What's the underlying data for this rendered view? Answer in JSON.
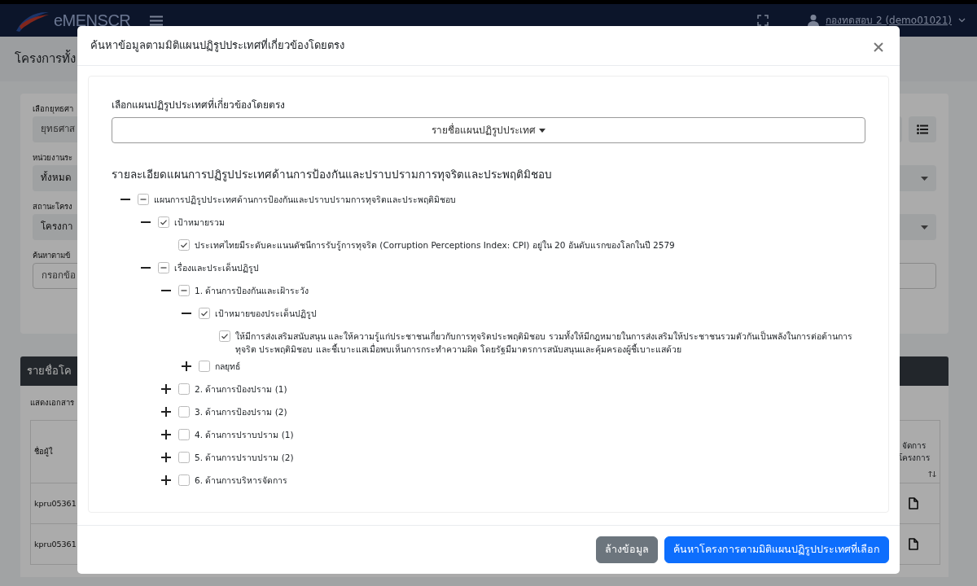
{
  "navbar": {
    "brand": "eMENSCR",
    "user": "กองทดสอบ 2 (demo01021)"
  },
  "page": {
    "title": "โครงการทั้ง",
    "filters": [
      {
        "label": "เลือกยุทธศา",
        "kind": "select",
        "placeholder": "ยุทธศาส",
        "list_button": true
      },
      {
        "label": "หน่วยงานระ",
        "kind": "select",
        "value": "ทั้งหมด",
        "list_button": false
      },
      {
        "label": "สถานะโครง",
        "kind": "select",
        "value": "โครงกา",
        "list_button": false
      },
      {
        "label": "ค้นหาตามข้",
        "kind": "input",
        "placeholder": "กรอกข้อ",
        "list_button": false
      }
    ],
    "section_title": "รายชื่อโค",
    "caption": "แสดงเอกสาร",
    "table": {
      "columns": [
        {
          "label": "ชื่อผู้ใ"
        },
        {
          "label": "จัดการ โครงการ",
          "sortable": true
        }
      ],
      "rows": [
        {
          "cells": [
            "kpru05361"
          ]
        },
        {
          "cells": [
            "kpru05361"
          ]
        }
      ]
    }
  },
  "modal": {
    "title": "ค้นหาข้อมูลตามมิติแผนปฏิรูปประเทศที่เกี่ยวข้องโดยตรง",
    "select_label": "เลือกแผนปฏิรูปประเทศที่เกี่ยวข้องโดยตรง",
    "dropdown": "รายชื่อแผนปฏิรูปประเทศ",
    "detail_heading": "รายละเอียดแผนการปฏิรูปประเทศด้านการป้องกันและปราบปรามการทุจริตและประพฤติมิชอบ",
    "tree": [
      {
        "label": "แผนการปฏิรูปประเทศด้านการป้องกันและปราบปรามการทุจริตและประพฤติมิชอบ",
        "indeterminate": true,
        "expanded": true,
        "children": [
          {
            "label": "เป้าหมายรวม",
            "checked": true,
            "indeterminate": false,
            "expanded": true,
            "children": [
              {
                "label": "ประเทศไทยมีระดับคะแนนดัชนีการรับรู้การทุจริต (Corruption Perceptions Index: CPI) อยู่ใน 20 อันดับแรกของโลกในปี 2579",
                "checked": true,
                "indeterminate": false
              }
            ]
          },
          {
            "label": "เรื่องและประเด็นปฏิรูป",
            "indeterminate": true,
            "expanded": true,
            "children": [
              {
                "label": "1. ด้านการป้องกันและเฝ้าระวัง",
                "indeterminate": true,
                "expanded": true,
                "children": [
                  {
                    "label": "เป้าหมายของประเด็นปฏิรูป",
                    "checked": true,
                    "indeterminate": false,
                    "expanded": true,
                    "children": [
                      {
                        "label": "ให้มีการส่งเสริมสนับสนุน และให้ความรู้แก่ประชาชนเกี่ยวกับการทุจริตประพฤติมิชอบ รวมทั้งให้มีกฎหมายในการส่งเสริมให้ประชาชนรวมตัวกันเป็นพลังในการต่อต้านการทุจริต ประพฤติมิชอบ และชี้เบาะแสเมื่อพบเห็นการกระทำความผิด โดยรัฐมีมาตรการสนับสนุนและคุ้มครองผู้ชี้เบาะแสด้วย",
                        "checked": true,
                        "indeterminate": false
                      }
                    ]
                  },
                  {
                    "label": "กลยุทธ์",
                    "checked": false,
                    "indeterminate": false,
                    "expanded": false
                  }
                ]
              },
              {
                "label": "2. ด้านการป้องปราม (1)",
                "checked": false,
                "indeterminate": false,
                "expanded": false
              },
              {
                "label": "3. ด้านการป้องปราม (2)",
                "checked": false,
                "indeterminate": false,
                "expanded": false
              },
              {
                "label": "4. ด้านการปราบปราม (1)",
                "checked": false,
                "indeterminate": false,
                "expanded": false
              },
              {
                "label": "5. ด้านการปราบปราม (2)",
                "checked": false,
                "indeterminate": false,
                "expanded": false
              },
              {
                "label": "6. ด้านการบริหารจัดการ",
                "checked": false,
                "indeterminate": false,
                "expanded": false
              }
            ]
          }
        ]
      }
    ],
    "buttons": [
      {
        "label": "ล้างข้อมูล",
        "kind": "secondary"
      },
      {
        "label": "ค้นหาโครงการตามมิติแผนปฏิรูปประเทศที่เลือก",
        "kind": "primary"
      }
    ]
  }
}
